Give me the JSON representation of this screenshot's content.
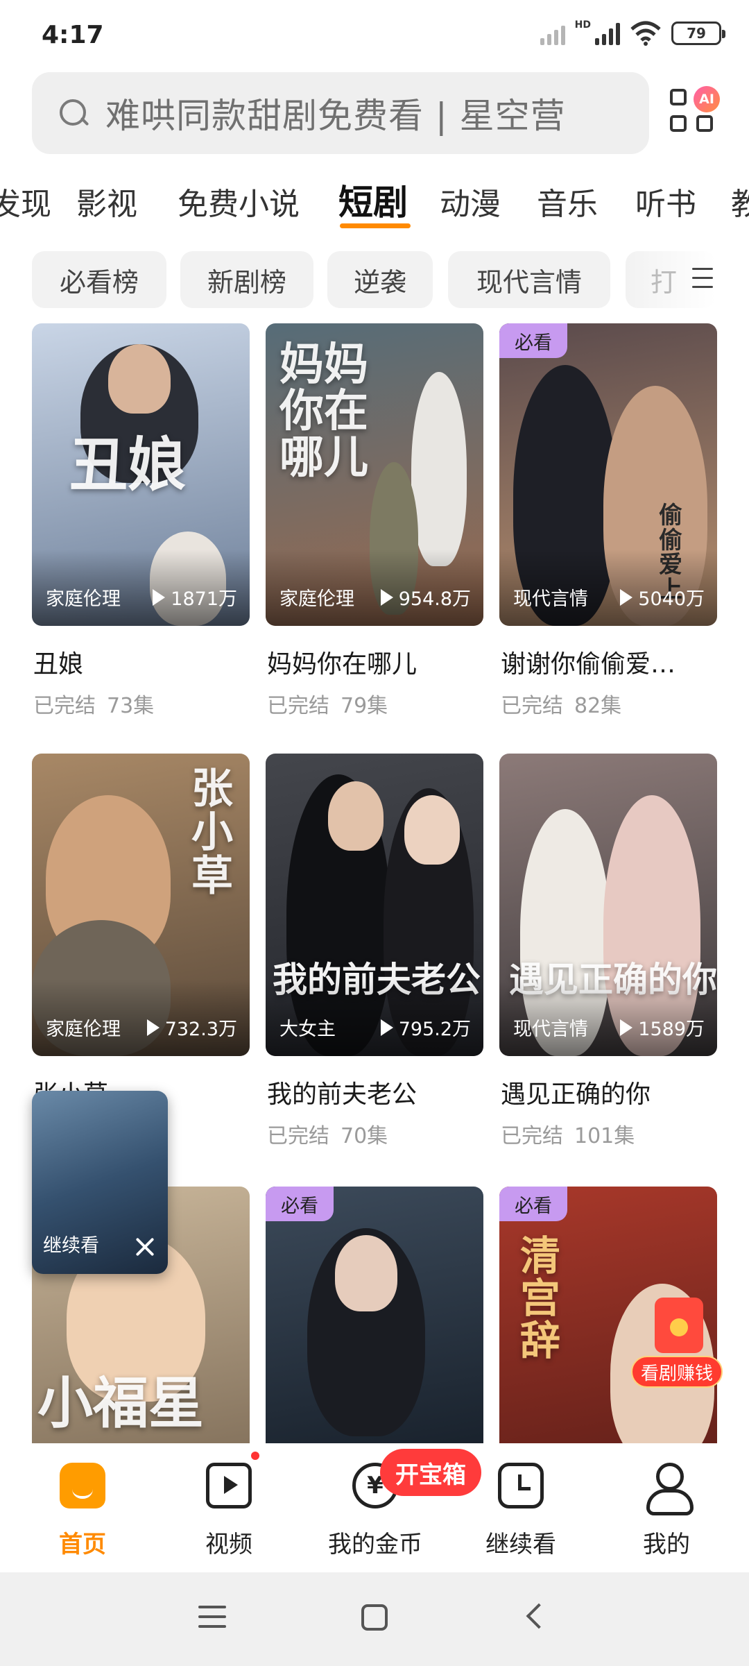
{
  "status_bar": {
    "time": "4:17",
    "network": "HD",
    "battery": "79"
  },
  "search": {
    "placeholder": "难哄同款甜剧免费看 | 星空营"
  },
  "ai_badge": "AI",
  "categories": [
    {
      "label": "发现"
    },
    {
      "label": "影视"
    },
    {
      "label": "免费小说"
    },
    {
      "label": "短剧",
      "active": true
    },
    {
      "label": "动漫"
    },
    {
      "label": "音乐"
    },
    {
      "label": "听书"
    },
    {
      "label": "教"
    }
  ],
  "chips": [
    {
      "label": "必看榜"
    },
    {
      "label": "新剧榜"
    },
    {
      "label": "逆袭"
    },
    {
      "label": "现代言情"
    },
    {
      "label": "打"
    }
  ],
  "dramas": [
    {
      "title": "丑娘",
      "genre": "家庭伦理",
      "plays": "1871万",
      "status": "已完结",
      "episodes": "73集",
      "poster_text": "丑娘",
      "colors": [
        "#c9d5e6",
        "#6c7e98"
      ]
    },
    {
      "title": "妈妈你在哪儿",
      "genre": "家庭伦理",
      "plays": "954.8万",
      "status": "已完结",
      "episodes": "79集",
      "poster_text": "妈妈你在哪儿",
      "colors": [
        "#566c78",
        "#9a6a4e"
      ]
    },
    {
      "title": "谢谢你偷偷爱…",
      "genre": "现代言情",
      "plays": "5040万",
      "status": "已完结",
      "episodes": "82集",
      "badge": "必看",
      "poster_text": "偷偷爱上",
      "colors": [
        "#5a4a4c",
        "#b8906e"
      ]
    },
    {
      "title": "张小草",
      "genre": "家庭伦理",
      "plays": "732.3万",
      "status": "",
      "episodes": "",
      "poster_text": "张小草",
      "colors": [
        "#a88866",
        "#5b4a3a"
      ]
    },
    {
      "title": "我的前夫老公",
      "genre": "大女主",
      "plays": "795.2万",
      "status": "已完结",
      "episodes": "70集",
      "poster_text": "我的前夫老公",
      "colors": [
        "#44464c",
        "#22242a"
      ]
    },
    {
      "title": "遇见正确的你",
      "genre": "现代言情",
      "plays": "1589万",
      "status": "已完结",
      "episodes": "101集",
      "poster_text": "遇见正确的你",
      "colors": [
        "#8c7a78",
        "#3e3a3c"
      ]
    },
    {
      "title": "",
      "genre": "",
      "plays": "",
      "status": "",
      "episodes": "",
      "poster_text": "小福星",
      "colors": [
        "#c9b69a",
        "#7c6a55"
      ]
    },
    {
      "title": "",
      "genre": "",
      "plays": "",
      "status": "",
      "episodes": "",
      "badge": "必看",
      "poster_text": "",
      "colors": [
        "#3c4a5a",
        "#141c26"
      ]
    },
    {
      "title": "",
      "genre": "",
      "plays": "",
      "status": "",
      "episodes": "",
      "badge": "必看",
      "poster_text": "清宫辞",
      "colors": [
        "#a8382a",
        "#5c1e18"
      ]
    }
  ],
  "continue_widget": {
    "label": "继续看"
  },
  "earn_badge": {
    "label": "看剧赚钱"
  },
  "treasure_badge": "开宝箱",
  "bottom_nav": [
    {
      "label": "首页",
      "active": true
    },
    {
      "label": "视频"
    },
    {
      "label": "我的金币"
    },
    {
      "label": "继续看"
    },
    {
      "label": "我的"
    }
  ],
  "colors": {
    "accent": "#ff8a00",
    "badge_purple": "#c79af0",
    "red": "#ff3b3b"
  }
}
